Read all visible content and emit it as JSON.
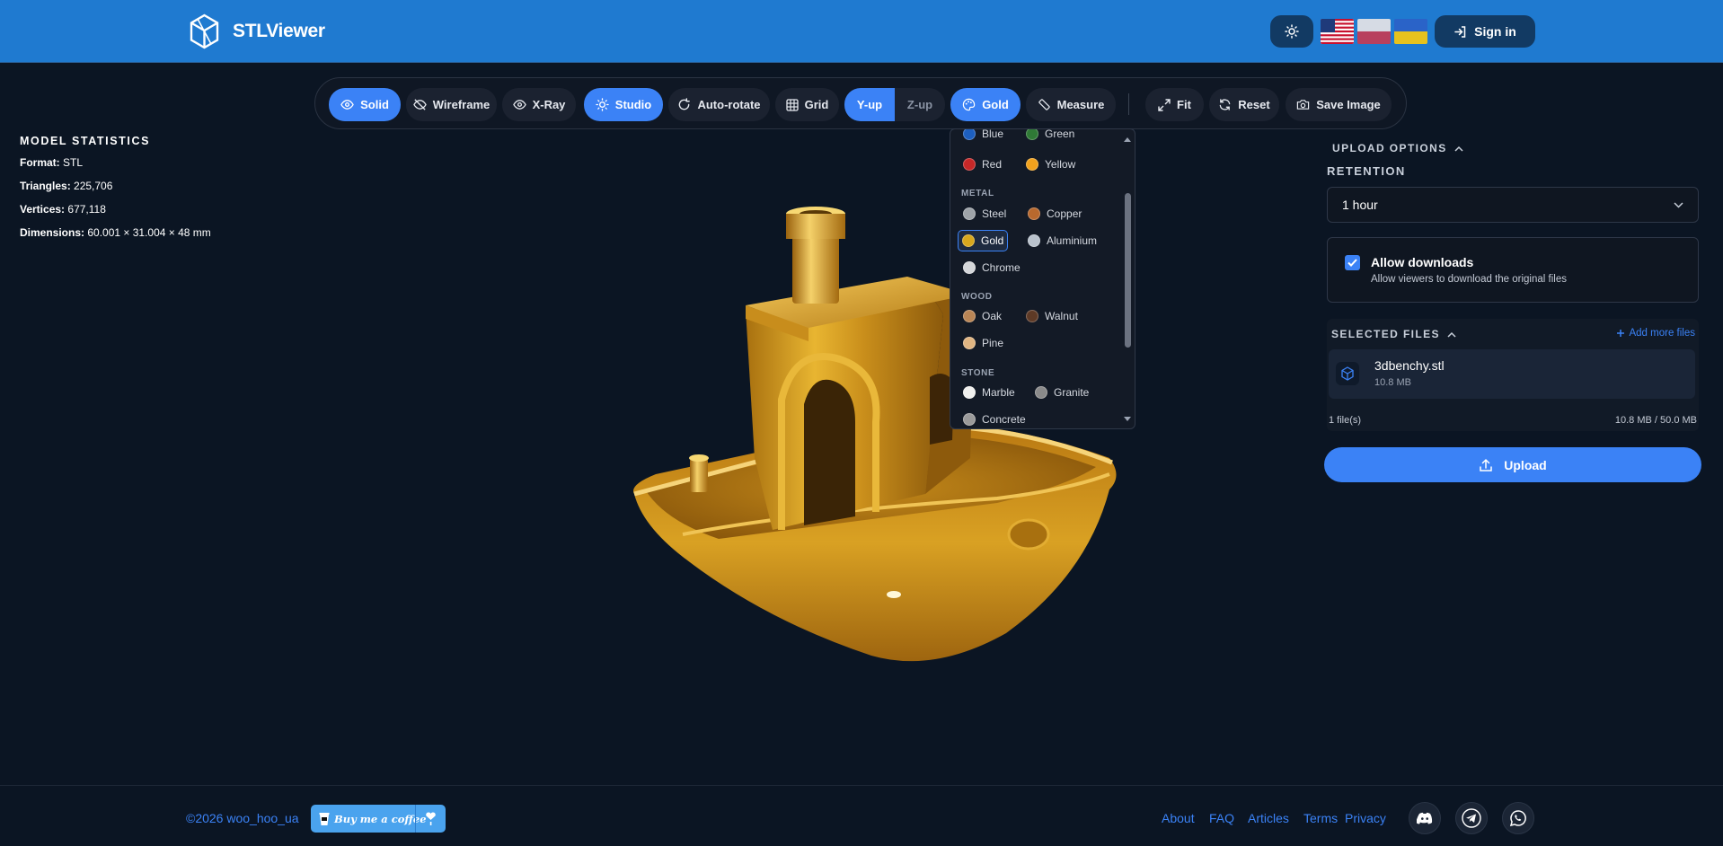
{
  "header": {
    "title": "STLViewer",
    "signin_label": "Sign in",
    "flags": [
      "us-flag",
      "pl-flag",
      "ua-flag"
    ]
  },
  "toolbar": {
    "solid": "Solid",
    "wireframe": "Wireframe",
    "xray": "X-Ray",
    "studio": "Studio",
    "autorotate": "Auto-rotate",
    "grid": "Grid",
    "yup": "Y-up",
    "zup": "Z-up",
    "material": "Gold",
    "measure": "Measure",
    "fit": "Fit",
    "reset": "Reset",
    "save": "Save Image",
    "active": [
      "Solid",
      "Studio",
      "Y-up",
      "Gold"
    ]
  },
  "stats": {
    "title": "MODEL STATISTICS",
    "format_label": "Format:",
    "format": "STL",
    "triangles_label": "Triangles:",
    "triangles": "225,706",
    "vertices_label": "Vertices:",
    "vertices": "677,118",
    "dimensions_label": "Dimensions:",
    "dimensions": "60.001 × 31.004 × 48 mm"
  },
  "materials": {
    "selected": "Gold",
    "categories": {
      "metal": "METAL",
      "wood": "WOOD",
      "stone": "STONE"
    },
    "colors": {
      "blue": {
        "label": "Blue",
        "hex": "#1d5fbf"
      },
      "green": {
        "label": "Green",
        "hex": "#2f7a36"
      },
      "red": {
        "label": "Red",
        "hex": "#c62828"
      },
      "yellow": {
        "label": "Yellow",
        "hex": "#f2a21d"
      },
      "steel": {
        "label": "Steel",
        "hex": "#9ea3a8"
      },
      "copper": {
        "label": "Copper",
        "hex": "#b8692e"
      },
      "gold": {
        "label": "Gold",
        "hex": "#d8a81e"
      },
      "aluminium": {
        "label": "Aluminium",
        "hex": "#b9c2cc"
      },
      "chrome": {
        "label": "Chrome",
        "hex": "#d4d6d9"
      },
      "oak": {
        "label": "Oak",
        "hex": "#b98555"
      },
      "walnut": {
        "label": "Walnut",
        "hex": "#5e3a26"
      },
      "pine": {
        "label": "Pine",
        "hex": "#e0b582"
      },
      "marble": {
        "label": "Marble",
        "hex": "#f0f0ee"
      },
      "granite": {
        "label": "Granite",
        "hex": "#8a8a8a"
      },
      "concrete": {
        "label": "Concrete",
        "hex": "#9a9a9a"
      }
    }
  },
  "upload_options": {
    "title": "UPLOAD OPTIONS",
    "retention_label": "RETENTION",
    "retention_value": "1 hour",
    "allow_title": "Allow downloads",
    "allow_desc": "Allow viewers to download the original files",
    "allow_checked": true
  },
  "selected_files": {
    "title": "SELECTED FILES",
    "add_more": "Add more files",
    "files": [
      {
        "name": "3dbenchy.stl",
        "size": "10.8 MB"
      }
    ],
    "count": "1 file(s)",
    "total": "10.8 MB / 50.0 MB"
  },
  "upload_label": "Upload",
  "footer": {
    "copyright": "©2026 woo_hoo_ua",
    "coffee": "Buy me a coffee",
    "links": [
      "About",
      "FAQ",
      "Articles",
      "Terms",
      "Privacy"
    ],
    "social": [
      "discord-icon",
      "telegram-icon",
      "whatsapp-icon"
    ]
  },
  "colors": {
    "header": "#1f7ad0",
    "accent": "#3b82f6",
    "background": "#0b1523",
    "model": "#d8a81e"
  }
}
